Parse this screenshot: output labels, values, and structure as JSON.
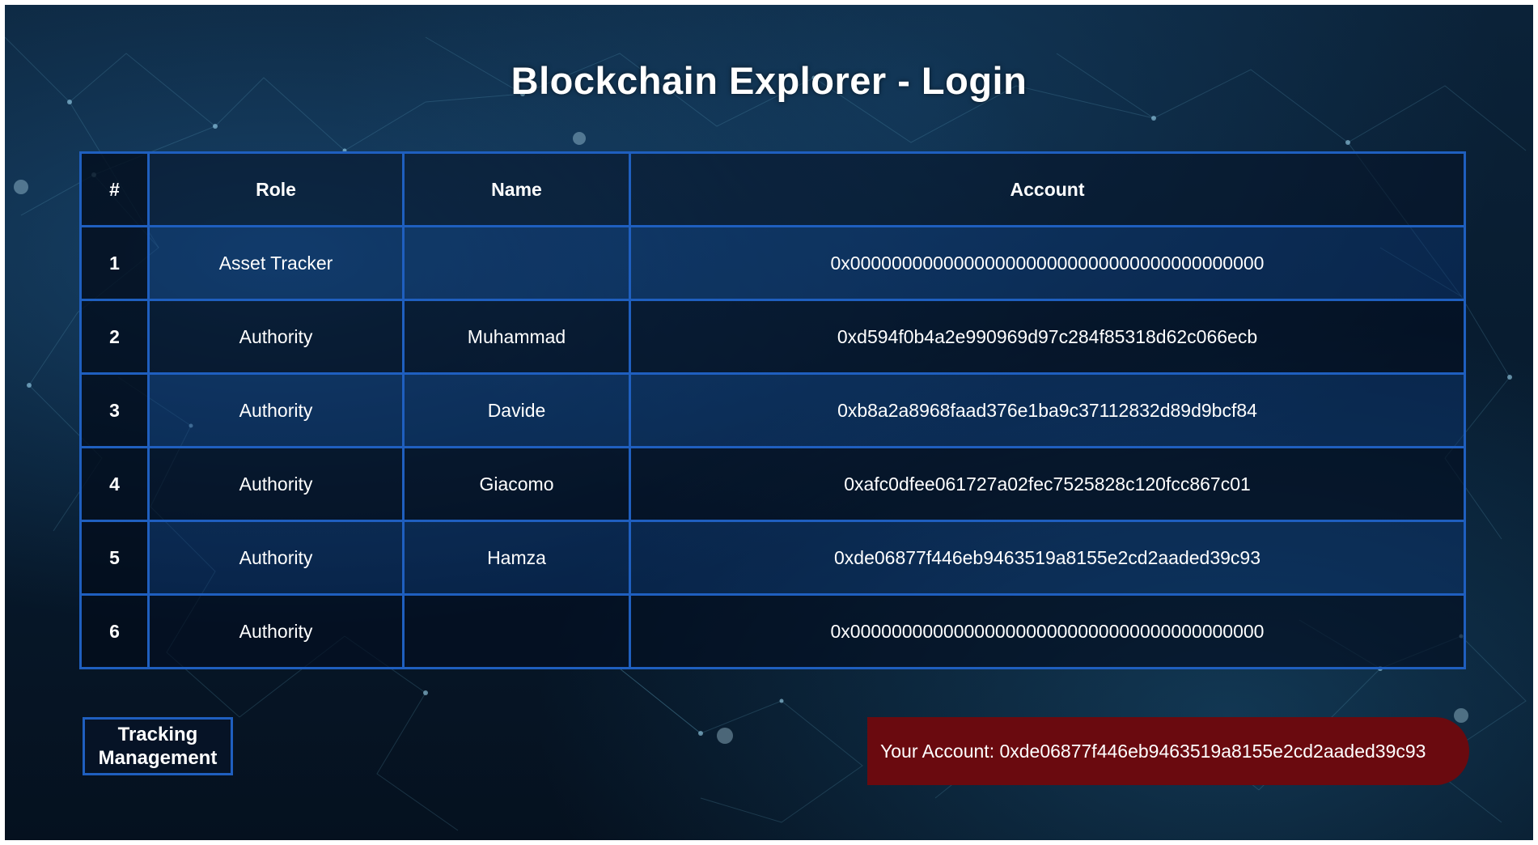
{
  "page": {
    "title": "Blockchain Explorer - Login"
  },
  "table": {
    "headers": {
      "num": "#",
      "role": "Role",
      "name": "Name",
      "account": "Account"
    },
    "rows": [
      {
        "num": "1",
        "role": "Asset Tracker",
        "name": "",
        "account": "0x0000000000000000000000000000000000000000"
      },
      {
        "num": "2",
        "role": "Authority",
        "name": "Muhammad",
        "account": "0xd594f0b4a2e990969d97c284f85318d62c066ecb"
      },
      {
        "num": "3",
        "role": "Authority",
        "name": "Davide",
        "account": "0xb8a2a8968faad376e1ba9c37112832d89d9bcf84"
      },
      {
        "num": "4",
        "role": "Authority",
        "name": "Giacomo",
        "account": "0xafc0dfee061727a02fec7525828c120fcc867c01"
      },
      {
        "num": "5",
        "role": "Authority",
        "name": "Hamza",
        "account": "0xde06877f446eb9463519a8155e2cd2aaded39c93"
      },
      {
        "num": "6",
        "role": "Authority",
        "name": "",
        "account": "0x0000000000000000000000000000000000000000"
      }
    ]
  },
  "actions": {
    "tracking_label_line1": "Tracking",
    "tracking_label_line2": "Management"
  },
  "account_badge": {
    "label": "Your Account: 0xde06877f446eb9463519a8155e2cd2aaded39c93"
  },
  "colors": {
    "table_border": "#1f5fbf",
    "badge_bg": "#6a0a0f",
    "background": "#071a2d"
  }
}
